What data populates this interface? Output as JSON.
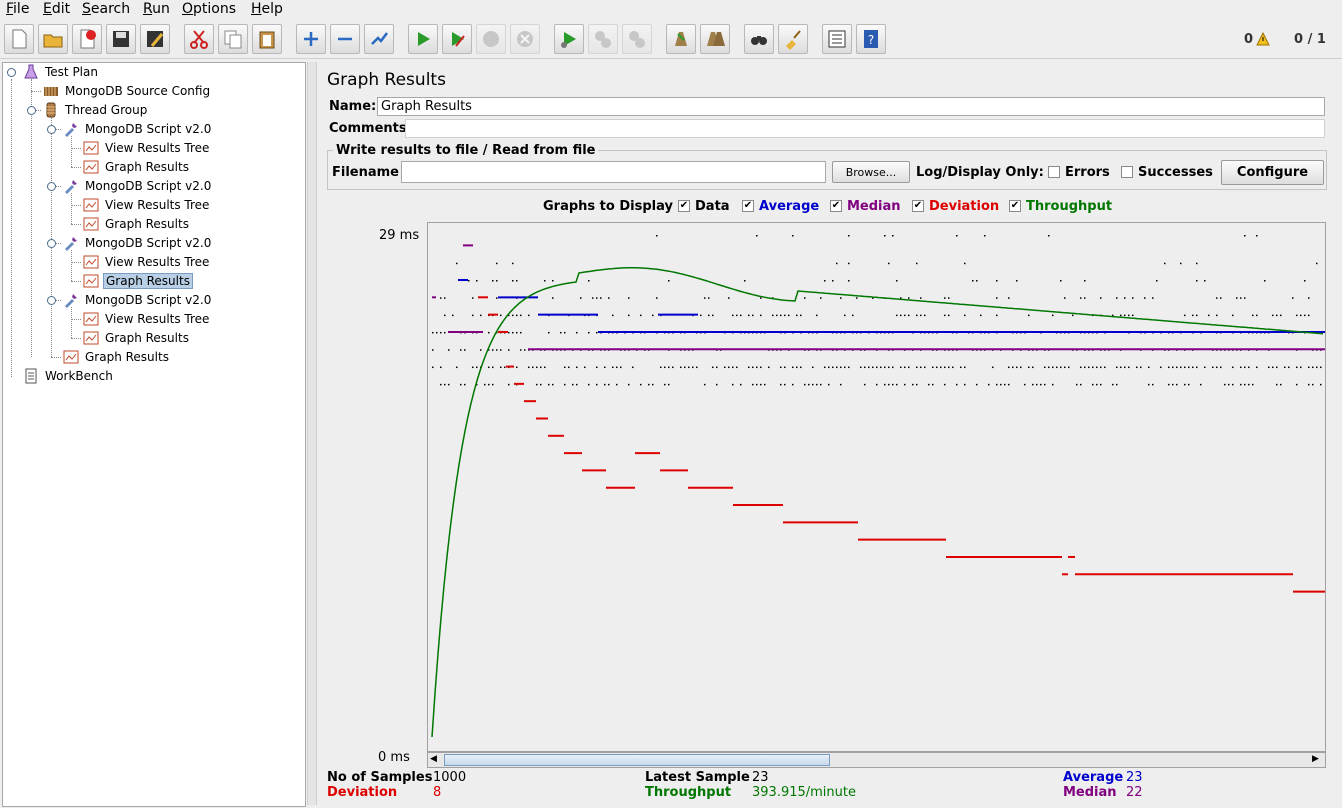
{
  "menu": [
    "File",
    "Edit",
    "Search",
    "Run",
    "Options",
    "Help"
  ],
  "toolbar": {
    "icons": [
      "new-icon",
      "open-icon",
      "close-icon",
      "save-icon",
      "save-as-icon",
      "cut-icon",
      "copy-icon",
      "paste-icon",
      "expand-icon",
      "collapse-icon",
      "toggle-icon",
      "start-icon",
      "start-no-pause-icon",
      "stop-icon",
      "shutdown-icon",
      "remote-start-icon",
      "remote-stop-icon",
      "remote-shutdown-icon",
      "clear-icon",
      "clear-all-icon",
      "search-icon",
      "reset-search-icon",
      "function-helper-icon",
      "help-icon"
    ],
    "warnings_count": "0",
    "threads": "0 / 1"
  },
  "tree": [
    {
      "label": "Test Plan",
      "icon": "test-plan-icon"
    },
    {
      "label": "MongoDB Source Config",
      "icon": "config-element-icon"
    },
    {
      "label": "Thread Group",
      "icon": "thread-group-icon"
    },
    {
      "label": "MongoDB Script v2.0",
      "icon": "sampler-pipette-icon"
    },
    {
      "label": "View Results Tree",
      "icon": "listener-icon"
    },
    {
      "label": "Graph Results",
      "icon": "listener-icon"
    },
    {
      "label": "MongoDB Script v2.0",
      "icon": "sampler-pipette-icon"
    },
    {
      "label": "View Results Tree",
      "icon": "listener-icon"
    },
    {
      "label": "Graph Results",
      "icon": "listener-icon"
    },
    {
      "label": "MongoDB Script v2.0",
      "icon": "sampler-pipette-icon"
    },
    {
      "label": "View Results Tree",
      "icon": "listener-icon"
    },
    {
      "label": "Graph Results",
      "icon": "listener-icon"
    },
    {
      "label": "MongoDB Script v2.0",
      "icon": "sampler-pipette-icon"
    },
    {
      "label": "View Results Tree",
      "icon": "listener-icon"
    },
    {
      "label": "Graph Results",
      "icon": "listener-icon"
    },
    {
      "label": "Graph Results",
      "icon": "listener-icon"
    },
    {
      "label": "WorkBench",
      "icon": "workbench-icon"
    }
  ],
  "panel": {
    "title": "Graph Results",
    "name_label": "Name:",
    "name_value": "Graph Results",
    "comments_label": "Comments:",
    "comments_value": "",
    "file_section_title": "Write results to file / Read from file",
    "filename_label": "Filename",
    "filename_value": "",
    "browse_label": "Browse...",
    "log_display_label": "Log/Display Only:",
    "errors_label": "Errors",
    "successes_label": "Successes",
    "configure_label": "Configure",
    "graphs_to_display_label": "Graphs to Display",
    "legend": {
      "data": "Data",
      "average": "Average",
      "median": "Median",
      "deviation": "Deviation",
      "throughput": "Throughput"
    },
    "colors": {
      "data": "#000000",
      "average": "#0000cc",
      "median": "#800080",
      "deviation": "#dd0000",
      "throughput": "#007700"
    }
  },
  "stats": {
    "no_of_samples_label": "No of Samples",
    "no_of_samples": "1000",
    "latest_sample_label": "Latest Sample",
    "latest_sample": "23",
    "average_label": "Average",
    "average": "23",
    "deviation_label": "Deviation",
    "deviation": "8",
    "throughput_label": "Throughput",
    "throughput": "393.915/minute",
    "median_label": "Median",
    "median": "22"
  },
  "chart_data": {
    "type": "line",
    "y_max_label": "29 ms",
    "y_min_label": "0 ms",
    "ylim": [
      0,
      29
    ],
    "series": [
      {
        "name": "Average",
        "note": "step line, stabilizes at ~23 ms",
        "values": [
          25,
          24,
          23,
          23,
          23
        ]
      },
      {
        "name": "Median",
        "note": "stabilizes at 22 ms",
        "values": [
          23,
          22,
          22,
          22,
          22
        ]
      },
      {
        "name": "Deviation",
        "note": "descending steps from ~20 ms to ~8 ms",
        "values": [
          20,
          15,
          13,
          11,
          10,
          9,
          8
        ]
      },
      {
        "name": "Throughput",
        "note": "rises quickly then slowly declines",
        "values": [
          0,
          26,
          27,
          27,
          26,
          25,
          24
        ]
      }
    ]
  }
}
